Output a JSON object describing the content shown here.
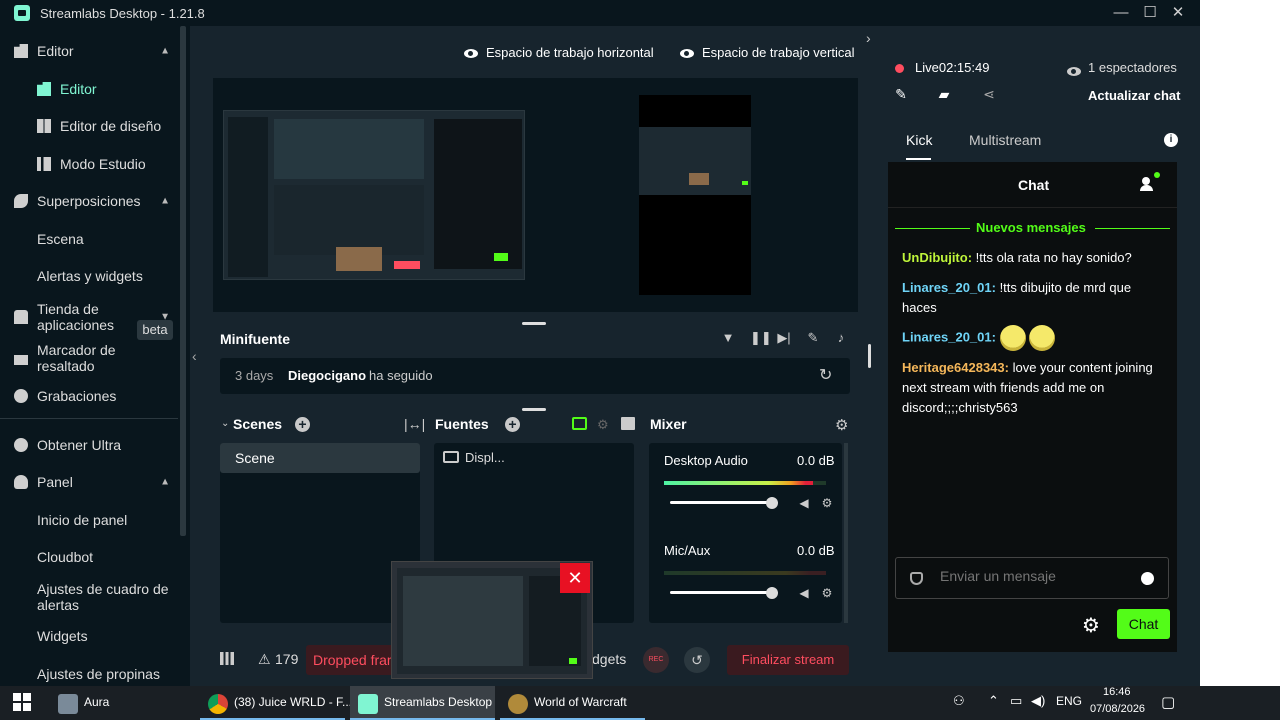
{
  "window": {
    "title": "Streamlabs Desktop - 1.21.8"
  },
  "sidebar": {
    "items": [
      {
        "label": "Editor",
        "icon": "editor-icon"
      },
      {
        "label": "Editor",
        "icon": "editor-icon"
      },
      {
        "label": "Editor de diseño",
        "icon": "layout-icon"
      },
      {
        "label": "Modo Estudio",
        "icon": "studio-icon"
      },
      {
        "label": "Superposiciones",
        "icon": "overlay-icon"
      },
      {
        "label": "Escena"
      },
      {
        "label": "Alertas y widgets"
      },
      {
        "label": "Tienda de aplicaciones",
        "icon": "store-icon"
      },
      {
        "label": "Marcador de resaltado",
        "icon": "highlighter-icon"
      },
      {
        "label": "Grabaciones",
        "icon": "recordings-icon"
      },
      {
        "label": "Obtener Ultra",
        "icon": "ultra-icon"
      },
      {
        "label": "Panel",
        "icon": "dashboard-icon"
      },
      {
        "label": "Inicio de panel"
      },
      {
        "label": "Cloudbot"
      },
      {
        "label": "Ajustes de cuadro de alertas"
      },
      {
        "label": "Widgets"
      },
      {
        "label": "Ajustes de propinas"
      }
    ],
    "beta_label": "beta"
  },
  "workspace": {
    "horizontal": "Espacio de trabajo horizontal",
    "vertical": "Espacio de trabajo vertical"
  },
  "minifeed": {
    "title": "Minifuente",
    "time": "3 days",
    "user": "Diegocigano",
    "action": "ha seguido"
  },
  "scenes": {
    "title": "Scenes",
    "items": [
      "Scene"
    ]
  },
  "sources": {
    "title": "Fuentes",
    "items": [
      "Displ..."
    ]
  },
  "mixer": {
    "title": "Mixer",
    "channels": [
      {
        "name": "Desktop Audio",
        "db": "0.0 dB",
        "level": 0.92
      },
      {
        "name": "Mic/Aux",
        "db": "0.0 dB",
        "level": 0.0
      }
    ]
  },
  "footer": {
    "dropped_count": "179",
    "dropped_label": "Dropped fram",
    "widgets_label": "dgets",
    "rec_label": "REC",
    "end_stream": "Finalizar stream"
  },
  "chat": {
    "live_label": "Live",
    "live_time": "02:15:49",
    "viewers": "1 espectadores",
    "update_chat": "Actualizar chat",
    "tabs": [
      "Kick",
      "Multistream"
    ],
    "header": "Chat",
    "new_messages": "Nuevos mensajes",
    "messages": [
      {
        "user": "UnDibujito:",
        "text": " !tts ola rata no hay sonido?",
        "color": "#bff53a"
      },
      {
        "user": "Linares_20_01:",
        "text": " !tts dibujito de mrd que haces",
        "color": "#6fd4f7"
      },
      {
        "user": "Linares_20_01:",
        "text": "",
        "color": "#6fd4f7"
      },
      {
        "user": "Heritage6428343:",
        "text": " love your content joining next stream with friends add me on discord;;;;christy563",
        "color": "#f5b75a"
      }
    ],
    "input_placeholder": "Enviar un mensaje",
    "send_label": "Chat",
    "accent": "#53fc18"
  },
  "taskbar": {
    "items": [
      {
        "label": "Aura"
      },
      {
        "label": "(38) Juice WRLD - F..."
      },
      {
        "label": "Streamlabs Desktop"
      },
      {
        "label": "World of Warcraft"
      }
    ],
    "lang": "ENG",
    "time": "16:46",
    "date": "07/08/2026"
  }
}
